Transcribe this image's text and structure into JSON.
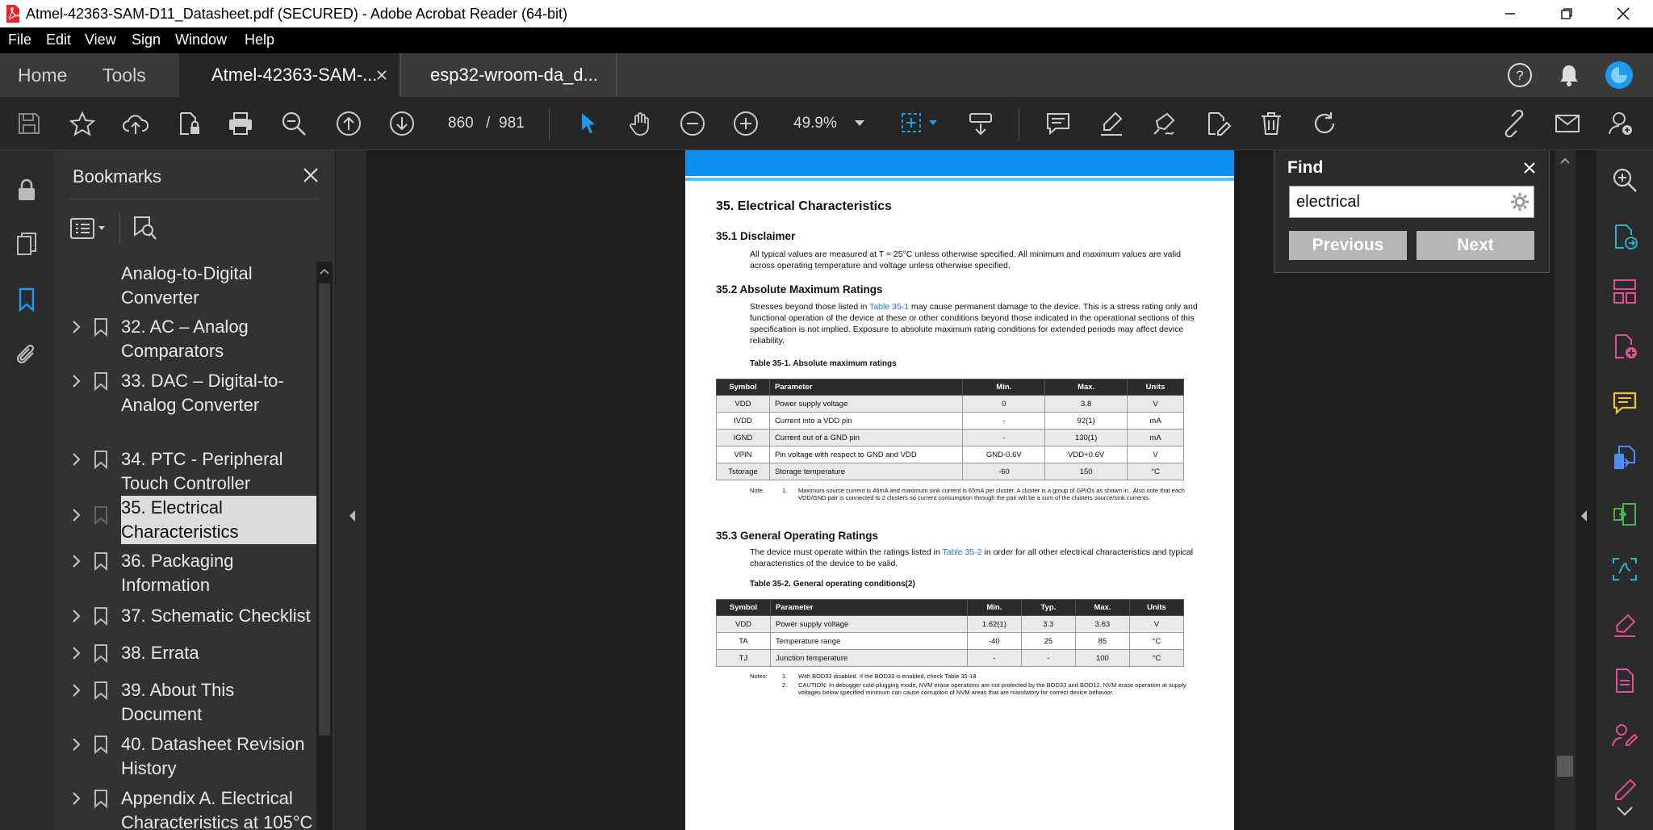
{
  "window": {
    "title": "Atmel-42363-SAM-D11_Datasheet.pdf (SECURED) - Adobe Acrobat Reader (64-bit)"
  },
  "menu": [
    "File",
    "Edit",
    "View",
    "Sign",
    "Window",
    "Help"
  ],
  "nav_tabs": {
    "home": "Home",
    "tools": "Tools"
  },
  "doc_tabs": {
    "active": "Atmel-42363-SAM-...",
    "other": "esp32-wroom-da_d..."
  },
  "toolbar": {
    "page_current": "860",
    "page_sep": "/",
    "page_total": "981",
    "zoom": "49.9%"
  },
  "bookmarks": {
    "title": "Bookmarks",
    "items": [
      {
        "label": "Analog-to-Digital Converter",
        "has_children": false,
        "selected": false
      },
      {
        "label": "32. AC – Analog Comparators",
        "has_children": true,
        "selected": false
      },
      {
        "label": "33. DAC – Digital-to-Analog Converter",
        "has_children": true,
        "selected": false
      },
      {
        "label": "34. PTC - Peripheral Touch Controller",
        "has_children": true,
        "selected": false
      },
      {
        "label": "35. Electrical Characteristics",
        "has_children": true,
        "selected": true
      },
      {
        "label": "36. Packaging Information",
        "has_children": true,
        "selected": false
      },
      {
        "label": "37. Schematic Checklist",
        "has_children": true,
        "selected": false
      },
      {
        "label": "38. Errata",
        "has_children": true,
        "selected": false
      },
      {
        "label": "39. About This Document",
        "has_children": true,
        "selected": false
      },
      {
        "label": "40. Datasheet Revision History",
        "has_children": true,
        "selected": false
      },
      {
        "label": "Appendix A. Electrical Characteristics at 105°C",
        "has_children": true,
        "selected": false
      }
    ]
  },
  "find": {
    "title": "Find",
    "query": "electrical",
    "previous": "Previous",
    "next": "Next"
  },
  "page": {
    "h35": "35.   Electrical Characteristics",
    "h351": "35.1   Disclaimer",
    "p351": "All typical values are measured at T = 25°C unless otherwise specified. All minimum and maximum values are valid across operating temperature and voltage unless otherwise specified.",
    "h352": "35.2   Absolute Maximum Ratings",
    "p352_a": "Stresses beyond those listed in ",
    "p352_link": "Table 35-1",
    "p352_b": " may cause permanent damage to the device. This is a stress rating only and functional operation of the device at these or other conditions beyond those indicated in the operational sections of this specification is not implied. Exposure to absolute maximum rating conditions for extended periods may affect device reliability.",
    "t1_caption": "Table 35-1.   Absolute maximum ratings",
    "t1_headers": [
      "Symbol",
      "Parameter",
      "Min.",
      "Max.",
      "Units"
    ],
    "t1_rows": [
      [
        "VDD",
        "Power supply voltage",
        "0",
        "3.8",
        "V"
      ],
      [
        "IVDD",
        "Current into a VDD pin",
        "-",
        "92(1)",
        "mA"
      ],
      [
        "IGND",
        "Current out of a GND pin",
        "-",
        "130(1)",
        "mA"
      ],
      [
        "VPIN",
        "Pin voltage with respect to GND and VDD",
        "GND-0.6V",
        "VDD+0.6V",
        "V"
      ],
      [
        "Tstorage",
        "Storage temperature",
        "-60",
        "150",
        "°C"
      ]
    ],
    "t1_note_label": "Note:",
    "t1_note_num": "1.",
    "t1_note": "Maximum source current is 46mA and maximum sink current is 65mA per cluster. A cluster is a group of GPIOs as shown in . Also note that each VDD/GND pair is connected to 2 clusters so current consumption through the pair will be a sum of the clusters source/sink currents.",
    "h353": "35.3   General Operating Ratings",
    "p353_a": "The device must operate within the ratings listed in ",
    "p353_link": "Table 35-2",
    "p353_b": " in order for all other electrical characteristics and typical characteristics of the device to be valid.",
    "t2_caption": "Table 35-2.   General operating conditions(2)",
    "t2_headers": [
      "Symbol",
      "Parameter",
      "Min.",
      "Typ.",
      "Max.",
      "Units"
    ],
    "t2_rows": [
      [
        "VDD",
        "Power supply voltage",
        "1.62(1)",
        "3.3",
        "3.63",
        "V"
      ],
      [
        "TA",
        "Temperature range",
        "-40",
        "25",
        "85",
        "°C"
      ],
      [
        "TJ",
        "Junction temperature",
        "-",
        "-",
        "100",
        "°C"
      ]
    ],
    "t2_notes_label": "Notes:",
    "t2_note1_num": "1.",
    "t2_note1": "With BOD33 disabled. If the BOD33 is enabled, check Table 35-18",
    "t2_note2_num": "2.",
    "t2_note2": "CAUTION: In debugger cold-plugging mode, NVM erase operations are not protected by the BOD33 and BOD12. NVM erase operation at supply voltages below specified minimum can cause corruption of NVM areas that are mandatory for correct device behavior."
  },
  "colors": {
    "accent": "#1a9bf0",
    "page_band": "#0a8ef0",
    "right_tool_pink": "#e0509a",
    "right_tool_teal": "#29b3c9",
    "right_tool_yellow": "#f2c31b",
    "right_tool_green": "#4caf50"
  }
}
